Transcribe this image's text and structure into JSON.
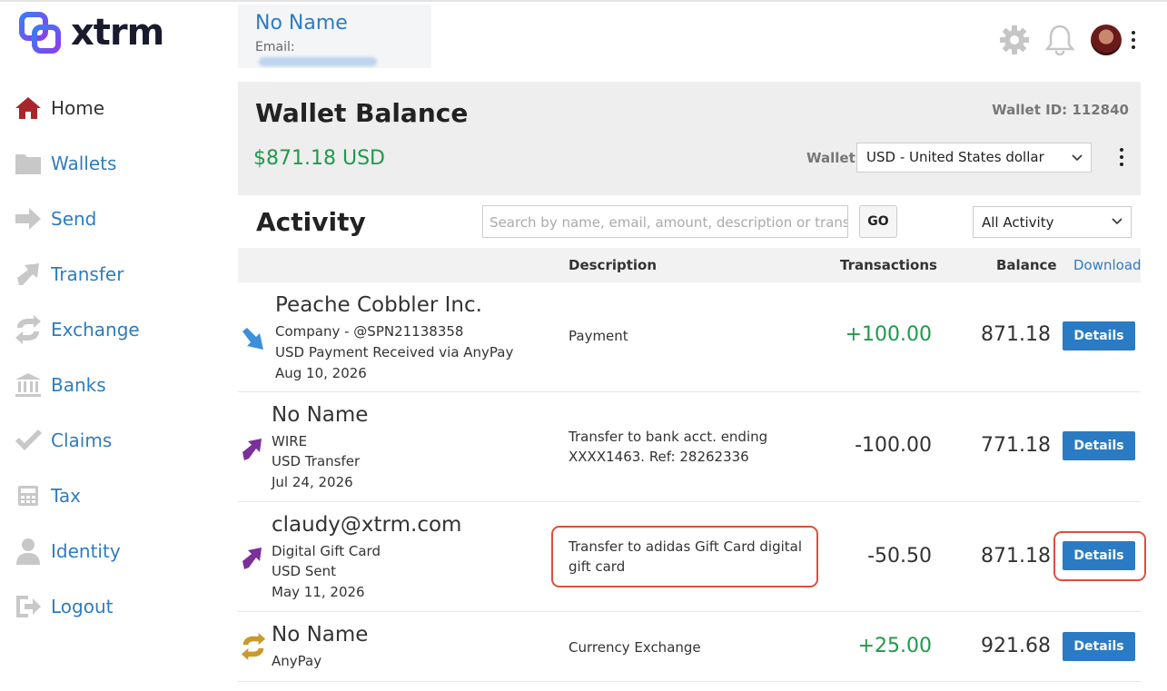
{
  "app": {
    "logo_text": "xtrm",
    "accent_color": "#2f7cc0",
    "brand_color": "#6a3df0"
  },
  "sidebar": {
    "items": [
      {
        "label": "Home",
        "icon": "home-icon",
        "active": true
      },
      {
        "label": "Wallets",
        "icon": "folder-icon"
      },
      {
        "label": "Send",
        "icon": "arrow-right-icon"
      },
      {
        "label": "Transfer",
        "icon": "arrow-up-right-icon"
      },
      {
        "label": "Exchange",
        "icon": "exchange-icon"
      },
      {
        "label": "Banks",
        "icon": "bank-icon"
      },
      {
        "label": "Claims",
        "icon": "check-icon"
      },
      {
        "label": "Tax",
        "icon": "calculator-icon"
      },
      {
        "label": "Identity",
        "icon": "person-icon"
      },
      {
        "label": "Logout",
        "icon": "logout-icon"
      }
    ]
  },
  "header": {
    "user_name": "No Name",
    "email_label": "Email:"
  },
  "wallet": {
    "title": "Wallet Balance",
    "amount": "$871.18 USD",
    "wallet_id": "Wallet ID: 112840",
    "select_label": "Wallet:",
    "select_value": "USD - United States dollar"
  },
  "activity": {
    "title": "Activity",
    "search_placeholder": "Search by name, email, amount, description or transa",
    "go_label": "GO",
    "filter_value": "All Activity",
    "columns": {
      "description": "Description",
      "transactions": "Transactions",
      "balance": "Balance",
      "download": "Download"
    },
    "rows": [
      {
        "name": "Peache Cobbler Inc.",
        "line1": "Company - @SPN21138358",
        "line2": "USD Payment Received via AnyPay",
        "date": "Aug 10, 2026",
        "description": "Payment",
        "amount": "+100.00",
        "balance": "871.18",
        "button": "Details",
        "icon": "incoming-arrow-icon"
      },
      {
        "name": "No Name",
        "line1": "WIRE",
        "line2": "USD Transfer",
        "date": "Jul 24, 2026",
        "description": "Transfer to bank acct. ending XXXX1463. Ref: 28262336",
        "amount": "-100.00",
        "balance": "771.18",
        "button": "Details",
        "icon": "outgoing-arrow-icon"
      },
      {
        "name": "claudy@xtrm.com",
        "line1": "Digital Gift Card",
        "line2": "USD Sent",
        "date": "May 11, 2026",
        "description": "Transfer to adidas Gift Card digital gift card",
        "amount": "-50.50",
        "balance": "871.18",
        "button": "Details",
        "icon": "outgoing-arrow-icon"
      },
      {
        "name": "No Name",
        "line1": "AnyPay",
        "description": "Currency Exchange",
        "amount": "+25.00",
        "balance": "921.68",
        "button": "Details",
        "icon": "exchange-icon"
      }
    ]
  }
}
